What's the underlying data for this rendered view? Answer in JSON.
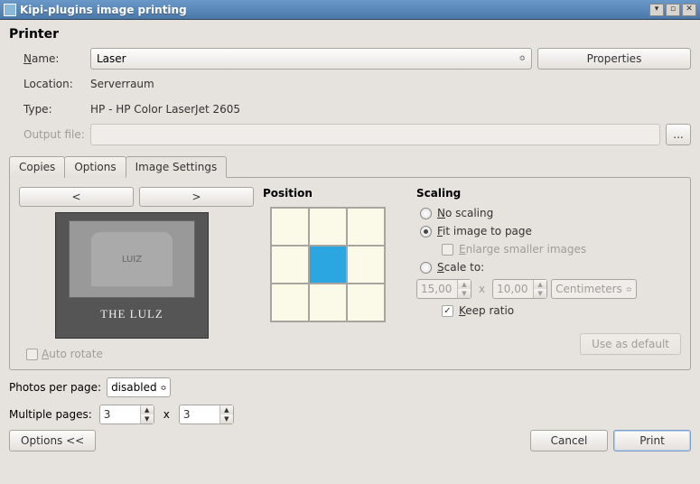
{
  "window": {
    "title": "Kipi-plugins image printing"
  },
  "printer": {
    "section": "Printer",
    "name_label": "Name:",
    "name_value": "Laser",
    "properties_btn": "Properties",
    "location_label": "Location:",
    "location_value": "Serverraum",
    "type_label": "Type:",
    "type_value": "HP - HP Color LaserJet 2605",
    "output_label": "Output file:",
    "output_browse": "..."
  },
  "tabs": {
    "copies": "Copies",
    "options": "Options",
    "image_settings": "Image Settings"
  },
  "preview": {
    "prev": "<",
    "next": ">",
    "title": "THE LULZ",
    "tomb": "LUIZ",
    "auto_rotate": "Auto rotate"
  },
  "position": {
    "heading": "Position"
  },
  "scaling": {
    "heading": "Scaling",
    "no_scaling": "No scaling",
    "fit_to_page": "Fit image to page",
    "enlarge": "Enlarge smaller images",
    "scale_to": "Scale to:",
    "width": "15,00",
    "height": "10,00",
    "x": "x",
    "unit": "Centimeters",
    "keep_ratio": "Keep ratio",
    "use_default": "Use as default"
  },
  "footer": {
    "photos_label": "Photos per page:",
    "photos_value": "disabled",
    "multiple_label": "Multiple pages:",
    "mcols": "3",
    "x": "x",
    "mrows": "3"
  },
  "bottom": {
    "options": "Options <<",
    "cancel": "Cancel",
    "print": "Print"
  }
}
